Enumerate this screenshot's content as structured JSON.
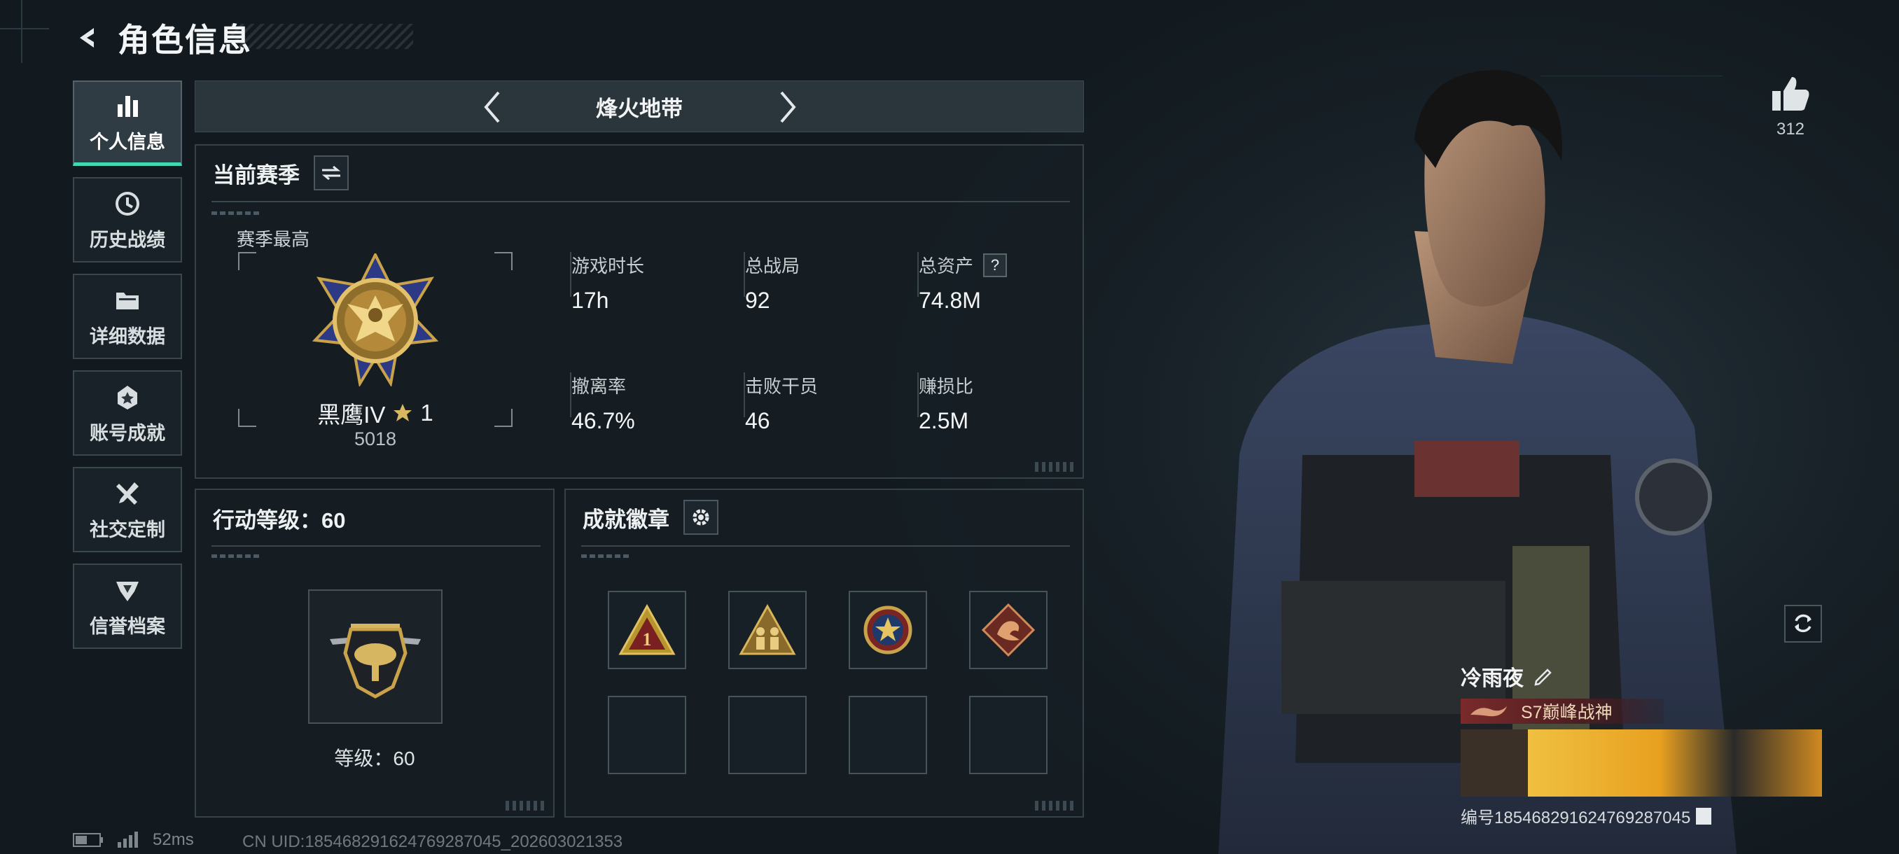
{
  "header": {
    "title": "角色信息"
  },
  "nav": {
    "items": [
      {
        "label": "个人信息",
        "icon": "bar-chart-icon",
        "active": true
      },
      {
        "label": "历史战绩",
        "icon": "history-icon",
        "active": false
      },
      {
        "label": "详细数据",
        "icon": "folder-icon",
        "active": false
      },
      {
        "label": "账号成就",
        "icon": "achievement-icon",
        "active": false
      },
      {
        "label": "社交定制",
        "icon": "tools-icon",
        "active": false
      },
      {
        "label": "信誉档案",
        "icon": "reputation-icon",
        "active": false
      }
    ]
  },
  "mode": {
    "title": "烽火地带"
  },
  "season": {
    "title": "当前赛季",
    "subtitle": "赛季最高",
    "rank_name": "黑鹰IV",
    "rank_stars": "1",
    "rank_score": "5018",
    "stats": [
      {
        "label": "游戏时长",
        "value": "17h"
      },
      {
        "label": "总战局",
        "value": "92"
      },
      {
        "label": "总资产",
        "value": "74.8M",
        "help": "?"
      },
      {
        "label": "撤离率",
        "value": "46.7%"
      },
      {
        "label": "击败干员",
        "value": "46"
      },
      {
        "label": "赚损比",
        "value": "2.5M"
      }
    ]
  },
  "level": {
    "title": "行动等级：60",
    "level_text": "等级：60"
  },
  "achievements": {
    "title": "成就徽章",
    "badges": [
      "rank-one-badge",
      "squad-badge",
      "star-seal-badge",
      "dragon-badge"
    ],
    "empty_slots": 4
  },
  "status": {
    "ping": "52ms",
    "uid": "CN UID:185468291624769287045_202603021353"
  },
  "player": {
    "likes": "312",
    "name": "冷雨夜",
    "title": "S7巅峰战神",
    "id_text": "编号1854682916247692870​45"
  },
  "colors": {
    "accent": "#3fd9b5",
    "gold": "#c9a24a",
    "panel_border": "#35424a"
  }
}
